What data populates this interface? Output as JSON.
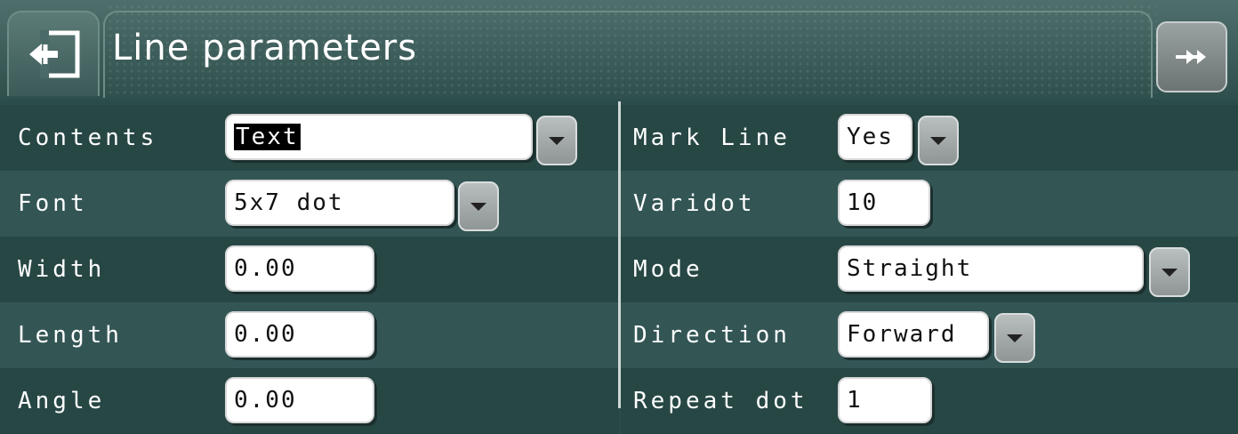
{
  "header": {
    "title": "Line parameters"
  },
  "left_rows": [
    {
      "label": "Contents",
      "value": "Text",
      "dropdown": true
    },
    {
      "label": "Font",
      "value": "5x7 dot",
      "dropdown": true
    },
    {
      "label": "Width",
      "value": "0.00",
      "dropdown": false
    },
    {
      "label": "Length",
      "value": "0.00",
      "dropdown": false
    },
    {
      "label": "Angle",
      "value": "0.00",
      "dropdown": false
    }
  ],
  "right_rows": [
    {
      "label": "Mark Line",
      "value": "Yes",
      "dropdown": true
    },
    {
      "label": "Varidot",
      "value": "10",
      "dropdown": false
    },
    {
      "label": "Mode",
      "value": "Straight",
      "dropdown": true
    },
    {
      "label": "Direction",
      "value": "Forward",
      "dropdown": true
    },
    {
      "label": "Repeat dot",
      "value": "1",
      "dropdown": false
    }
  ],
  "icons": {
    "back": "exit-icon",
    "fast_forward": "double-arrow-right-icon",
    "dropdown": "caret-down-icon"
  }
}
